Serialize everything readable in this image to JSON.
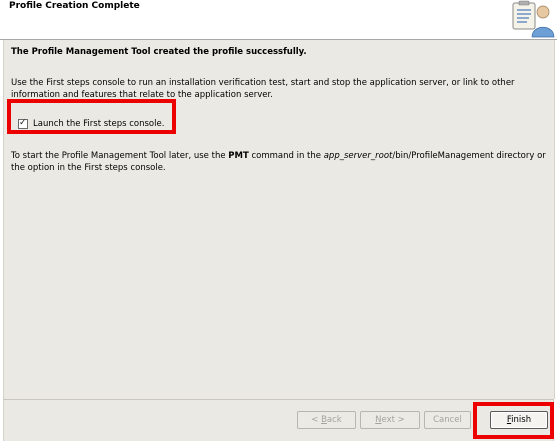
{
  "header": {
    "title": "Profile Creation Complete",
    "icon": "wizard-clipboard-person-icon"
  },
  "content": {
    "success_message": "The Profile Management Tool created the profile successfully.",
    "console_description": "Use the First steps console to run an installation verification test, start and stop the application server, or link to other information and features that relate to the application server.",
    "launch_checkbox": {
      "checked": true,
      "label": "Launch the First steps console."
    },
    "restart_info": {
      "before_cmd": "To start the Profile Management Tool later, use the ",
      "command": "PMT",
      "middle": " command in the ",
      "path_italic": "app_server_root",
      "after": "/bin/ProfileManagement directory or the option in the First steps console."
    }
  },
  "buttons": {
    "back": {
      "prefix": "< ",
      "mnemonic": "B",
      "rest": "ack",
      "enabled": false
    },
    "next": {
      "mnemonic": "N",
      "rest": "ext >",
      "enabled": false
    },
    "cancel": {
      "label": "Cancel",
      "enabled": false
    },
    "finish": {
      "mnemonic": "F",
      "rest": "inish",
      "enabled": true
    }
  },
  "colors": {
    "highlight": "#ec0000",
    "panel_background": "#ebe9e3",
    "disabled_text": "#a5a39d"
  }
}
